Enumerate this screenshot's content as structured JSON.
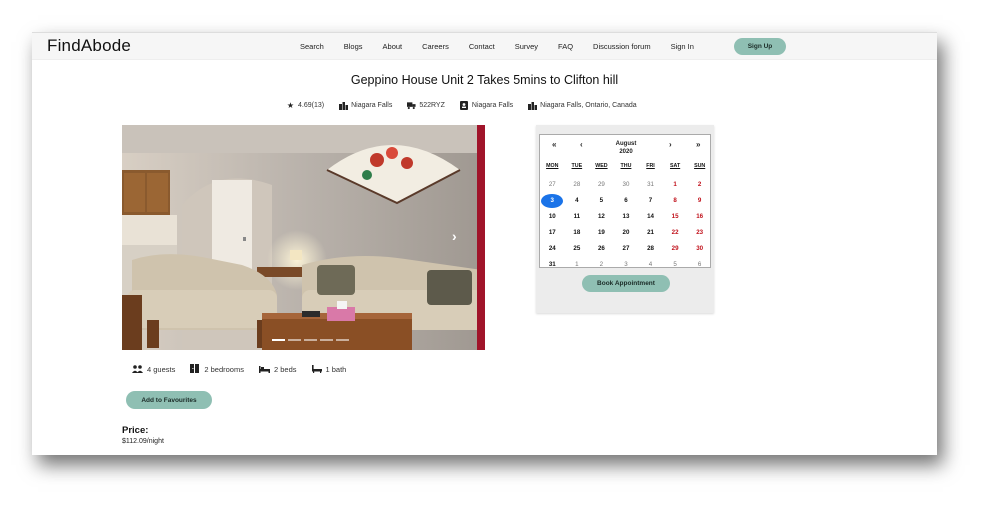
{
  "brand": "FindAbode",
  "nav": {
    "links": [
      "Search",
      "Blogs",
      "About",
      "Careers",
      "Contact",
      "Survey",
      "FAQ",
      "Discussion forum",
      "Sign In"
    ],
    "signup_label": "Sign Up"
  },
  "listing": {
    "title": "Geppino House Unit 2 Takes 5mins to Clifton hill",
    "rating": "4.69(13)",
    "city": "Niagara Falls",
    "code": "522RYZ",
    "host_location": "Niagara Falls",
    "address": "Niagara Falls, Ontario, Canada"
  },
  "calendar": {
    "first_label": "«",
    "prev_label": "‹",
    "next_label": "›",
    "last_label": "»",
    "month": "August",
    "year": "2020",
    "weekdays": [
      "MON",
      "TUE",
      "WED",
      "THU",
      "FRI",
      "SAT",
      "SUN"
    ],
    "weeks": [
      [
        "27",
        "28",
        "29",
        "30",
        "31",
        "1",
        "2"
      ],
      [
        "3",
        "4",
        "5",
        "6",
        "7",
        "8",
        "9"
      ],
      [
        "10",
        "11",
        "12",
        "13",
        "14",
        "15",
        "16"
      ],
      [
        "17",
        "18",
        "19",
        "20",
        "21",
        "22",
        "23"
      ],
      [
        "24",
        "25",
        "26",
        "27",
        "28",
        "29",
        "30"
      ],
      [
        "31",
        "1",
        "2",
        "3",
        "4",
        "5",
        "6"
      ]
    ],
    "selected": "3",
    "book_label": "Book Appointment"
  },
  "amenities": {
    "guests": "4 guests",
    "bedrooms": "2 bedrooms",
    "beds": "2 beds",
    "baths": "1 bath"
  },
  "favourites_label": "Add to Favourites",
  "price": {
    "label": "Price:",
    "value": "$112.09/night"
  },
  "colors": {
    "accent": "#8fbfb3",
    "selected_day": "#1a73e8",
    "weekend": "#c0101a"
  }
}
